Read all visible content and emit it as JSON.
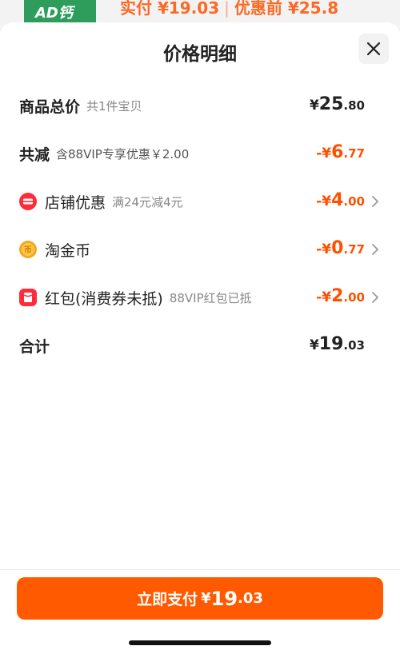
{
  "background": {
    "thumb_text": "AD钙",
    "pay_label": "实付 ¥19.03",
    "pre_discount_label": "优惠前 ¥25.8"
  },
  "sheet": {
    "title": "价格明细",
    "close_icon": "close-icon"
  },
  "rows": {
    "goods_total": {
      "label": "商品总价",
      "sub": "共1件宝贝",
      "amount_yen": "¥",
      "amount_int": "25",
      "amount_dec": ".80"
    },
    "total_discount": {
      "label": "共减",
      "sub": "含88VIP专享优惠￥2.00",
      "amount_yen": "-¥",
      "amount_int": "6",
      "amount_dec": ".77"
    },
    "shop_discount": {
      "icon": "shop-coupon-icon",
      "label": "店铺优惠",
      "sub": "满24元减4元",
      "amount_yen": "-¥",
      "amount_int": "4",
      "amount_dec": ".00"
    },
    "taojinbi": {
      "icon": "gold-coin-icon",
      "label": "淘金币",
      "sub": "",
      "amount_yen": "-¥",
      "amount_int": "0",
      "amount_dec": ".77"
    },
    "red_packet": {
      "icon": "red-packet-icon",
      "label": "红包(消费券未抵)",
      "sub": "88VIP红包已抵",
      "amount_yen": "-¥",
      "amount_int": "2",
      "amount_dec": ".00"
    },
    "total": {
      "label": "合计",
      "amount_yen": "¥",
      "amount_int": "19",
      "amount_dec": ".03"
    }
  },
  "footer": {
    "pay_button_label": "立即支付",
    "pay_yen": "¥",
    "pay_int": "19",
    "pay_dec": ".03"
  },
  "colors": {
    "accent": "#ff5000",
    "pay_button": "#ff5a00",
    "text_primary": "#222222",
    "text_secondary": "#888888"
  }
}
